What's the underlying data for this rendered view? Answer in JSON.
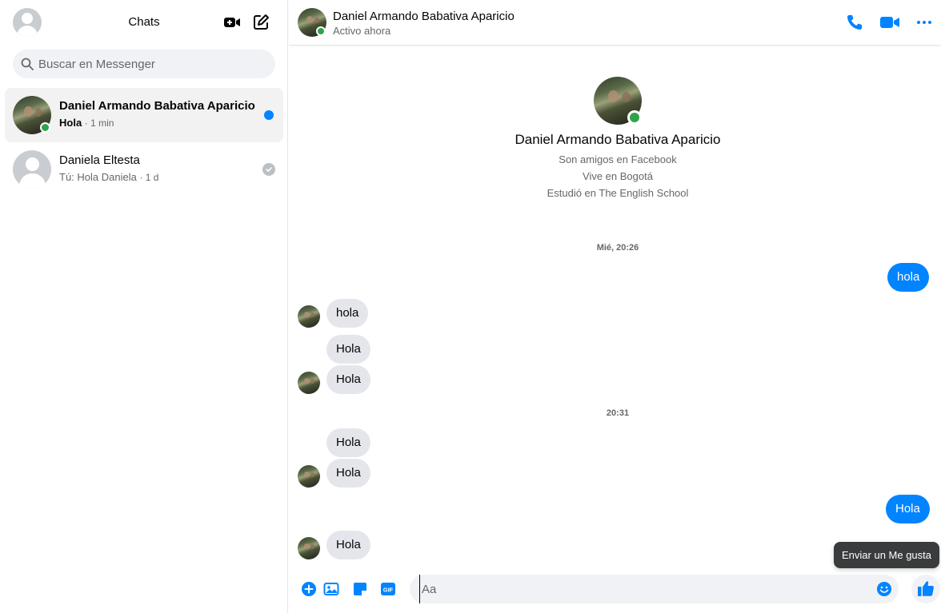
{
  "sidebar": {
    "title": "Chats",
    "search_placeholder": "Buscar en Messenger",
    "chats": [
      {
        "name": "Daniel Armando Babativa Aparicio",
        "last_message": "Hola",
        "time": "1 min",
        "unread": true,
        "online": true
      },
      {
        "name": "Daniela Eltesta",
        "last_message": "Tú: Hola Daniela",
        "time": "1 d",
        "unread": false,
        "online": false
      }
    ]
  },
  "conversation": {
    "name": "Daniel Armando Babativa Aparicio",
    "status": "Activo ahora",
    "profile": {
      "name": "Daniel Armando Babativa Aparicio",
      "lines": [
        "Son amigos en Facebook",
        "Vive en Bogotá",
        "Estudió en The English School"
      ]
    },
    "timestamps": [
      "Mié, 20:26",
      "20:31"
    ],
    "messages": [
      {
        "from": "me",
        "text": "hola"
      },
      {
        "from": "them",
        "text": "hola"
      },
      {
        "from": "them",
        "text": "Hola"
      },
      {
        "from": "them",
        "text": "Hola"
      },
      {
        "from": "them",
        "text": "Hola"
      },
      {
        "from": "them",
        "text": "Hola"
      },
      {
        "from": "me",
        "text": "Hola"
      },
      {
        "from": "them",
        "text": "Hola"
      }
    ]
  },
  "composer": {
    "placeholder": "Aa",
    "like_tooltip": "Enviar un Me gusta"
  },
  "icons": {
    "header_left": [
      "new-video-call-icon",
      "compose-icon"
    ],
    "header_right": [
      "phone-icon",
      "video-camera-icon",
      "more-options-icon"
    ],
    "composer": [
      "add-icon",
      "photo-icon",
      "sticker-icon",
      "gif-icon",
      "emoji-icon",
      "like-icon"
    ]
  },
  "colors": {
    "accent": "#0084ff",
    "online": "#31a24c",
    "incoming_bubble": "#e4e6eb"
  }
}
